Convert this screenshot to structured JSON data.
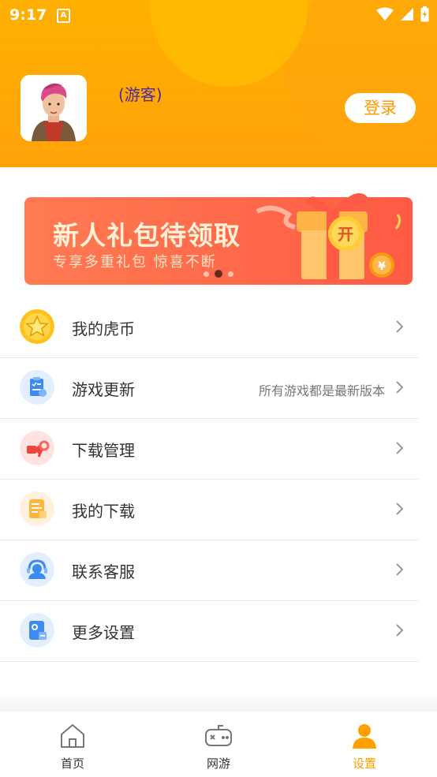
{
  "status_bar": {
    "time": "9:17",
    "app_glyph": "A"
  },
  "profile": {
    "username": "(游客)",
    "login_label": "登录"
  },
  "banner": {
    "title": "新人礼包待领取",
    "subtitle": "专享多重礼包 惊喜不断",
    "badge": "开",
    "coin_symbol": "¥"
  },
  "menu": [
    {
      "label": "我的虎币",
      "hint": "",
      "icon": "star-coin-icon"
    },
    {
      "label": "游戏更新",
      "hint": "所有游戏都是最新版本",
      "icon": "update-clipboard-icon"
    },
    {
      "label": "下载管理",
      "hint": "",
      "icon": "download-manage-icon"
    },
    {
      "label": "我的下载",
      "hint": "",
      "icon": "my-download-icon"
    },
    {
      "label": "联系客服",
      "hint": "",
      "icon": "customer-service-icon"
    },
    {
      "label": "更多设置",
      "hint": "",
      "icon": "settings-doc-icon"
    }
  ],
  "bottom_nav": [
    {
      "label": "首页",
      "icon": "home-icon",
      "active": false
    },
    {
      "label": "网游",
      "icon": "gamepad-icon",
      "active": false
    },
    {
      "label": "设置",
      "icon": "user-icon",
      "active": true
    }
  ],
  "colors": {
    "accent": "#ffa000",
    "header": "#ffa20a",
    "username": "#4a2aa0",
    "banner": "#ff6a4a"
  }
}
